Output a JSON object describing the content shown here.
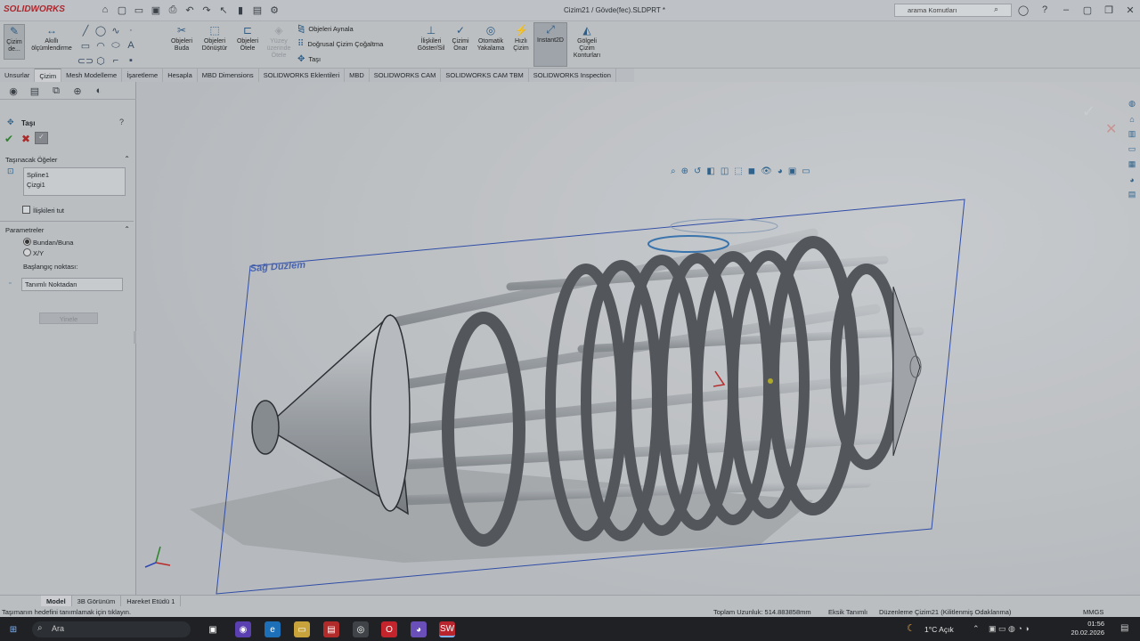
{
  "app": {
    "brand": "SOLIDWORKS",
    "document_title": "Cizim21 / Gövde(fec).SLDPRT *"
  },
  "search": {
    "placeholder": "arama Komutları"
  },
  "ribbon": {
    "sketch": "Çizim de...",
    "smart_dimension": "Akıllı ölçümlendirme",
    "trim": "Objeleri Buda",
    "convert": "Objeleri Dönüştür",
    "offset": "Objeleri Ötele",
    "offset_surface": "Yüzey üzerinde Ötele",
    "mirror": "Objeleri Aynala",
    "linear_pattern": "Doğrusal Çizim Çoğaltma",
    "move": "Taşı",
    "relations": "İlişkileri Göster/Sil",
    "repair": "Çizimi Onar",
    "quick_snaps": "Otomatik Yakalama",
    "rapid_sketch": "Hızlı Çizim",
    "instant2d": "Instant2D",
    "shaded_contours": "Gölgeli Çizim Konturları"
  },
  "tabs": [
    "Unsurlar",
    "Çizim",
    "Mesh Modelleme",
    "İşaretleme",
    "Hesapla",
    "MBD Dimensions",
    "SOLIDWORKS Eklentileri",
    "MBD",
    "SOLIDWORKS CAM",
    "SOLIDWORKS CAM TBM",
    "SOLIDWORKS Inspection"
  ],
  "active_tab": "Çizim",
  "property_manager": {
    "title": "Taşı",
    "section_items": "Taşınacak Öğeler",
    "items": [
      "Spline1",
      "Çizgi1"
    ],
    "keep_relations": "İlişkileri tut",
    "section_params": "Parametreler",
    "radio_from_to": "Bundan/Buna",
    "radio_xy": "X/Y",
    "start_point": "Başlangıç noktası:",
    "start_value": "Tanımlı Noktadan",
    "repeat_button": "Yinele"
  },
  "viewport": {
    "plane_label": "Sağ Düzlem"
  },
  "bottom_tabs": [
    "Model",
    "3B Görünüm",
    "Hareket Etüdü 1"
  ],
  "status": {
    "hint": "Taşımanın hedefini tanımlamak için tıklayın.",
    "total_length": "Toplam Uzunluk: 514.883858mm",
    "definition": "Eksik Tanımlı",
    "editing": "Düzenleme Çizim21 (Kilitlenmiş Odaklanma)",
    "units": "MMGS"
  },
  "taskbar": {
    "search": "Ara",
    "weather": "1°C  Açık",
    "time": "01:56",
    "date": "20.02.2026"
  }
}
